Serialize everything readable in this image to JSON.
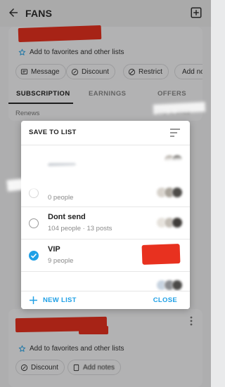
{
  "topbar": {
    "title": "FANS"
  },
  "card1": {
    "favorites_label": "Add to favorites and other lists",
    "chips": [
      "Message",
      "Discount",
      "Restrict",
      "Add no"
    ]
  },
  "tabs": {
    "subscription": "SUBSCRIPTION",
    "earnings": "EARNINGS",
    "offers": "OFFERS"
  },
  "renews_label": "Renews",
  "renews_value": "Sep 3, 2022",
  "dialog": {
    "title": "SAVE TO LIST",
    "lists": [
      {
        "name": "",
        "subtitle": "",
        "checked": false
      },
      {
        "name": "",
        "subtitle": "0 people",
        "checked": false
      },
      {
        "name": "Dont send",
        "subtitle": "104 people · 13 posts",
        "checked": false
      },
      {
        "name": "VIP",
        "subtitle": "9 people",
        "checked": true
      }
    ],
    "new_list_label": "NEW LIST",
    "close_label": "CLOSE"
  },
  "card2": {
    "favorites_label": "Add to favorites and other lists",
    "chips": [
      "Discount",
      "Add notes"
    ]
  },
  "colors": {
    "accent": "#1fa0e6",
    "redaction": "#e8311f",
    "overlay": "rgba(0,0,0,0.28)"
  }
}
